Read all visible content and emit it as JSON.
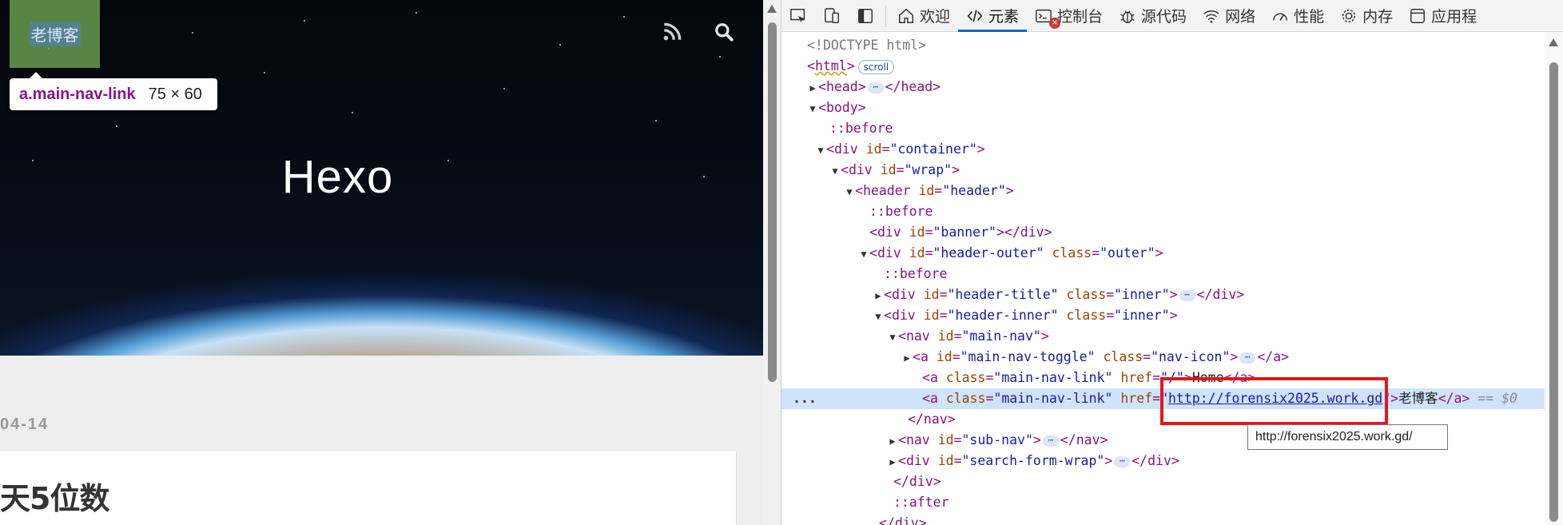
{
  "page": {
    "nav_link_text": "老博客",
    "site_title": "Hexo",
    "date_text": "04-14",
    "article_title": "天5位数",
    "inspect_tooltip": {
      "selector": "a.main-nav-link",
      "size": "75 × 60"
    }
  },
  "devtools": {
    "tabs": [
      {
        "label": "欢迎",
        "icon": "home-icon"
      },
      {
        "label": "元素",
        "icon": "code-icon",
        "active": true
      },
      {
        "label": "控制台",
        "icon": "console-icon"
      },
      {
        "label": "源代码",
        "icon": "bug-icon"
      },
      {
        "label": "网络",
        "icon": "wifi-icon"
      },
      {
        "label": "性能",
        "icon": "gauge-icon"
      },
      {
        "label": "内存",
        "icon": "gear-icon"
      },
      {
        "label": "应用程",
        "icon": "app-icon"
      }
    ],
    "dom": {
      "doctype": "<!DOCTYPE html>",
      "html_tag": "html",
      "scroll_badge": "scroll",
      "head_tag": "head",
      "body_tag": "body",
      "before": "::before",
      "after": "::after",
      "div": "div",
      "id": "id",
      "class": "class",
      "href": "href",
      "container": "\"container\"",
      "wrap": "\"wrap\"",
      "header_tag": "header",
      "header_id": "\"header\"",
      "banner": "\"banner\"",
      "header_outer": "\"header-outer\"",
      "outer": "\"outer\"",
      "header_title": "\"header-title\"",
      "inner": "\"inner\"",
      "header_inner": "\"header-inner\"",
      "nav_tag": "nav",
      "main_nav": "\"main-nav\"",
      "a_tag": "a",
      "main_nav_toggle": "\"main-nav-toggle\"",
      "nav_icon": "\"nav-icon\"",
      "main_nav_link": "\"main-nav-link\"",
      "home_href": "\"/\"",
      "home_text": "Home",
      "selected_href": "http://forensix2025.work.gd",
      "selected_text": "老博客",
      "selected_ref": "== $0",
      "sub_nav": "\"sub-nav\"",
      "search_form_wrap": "\"search-form-wrap\"",
      "link_tooltip": "http://forensix2025.work.gd/",
      "row_dots": "..."
    }
  }
}
